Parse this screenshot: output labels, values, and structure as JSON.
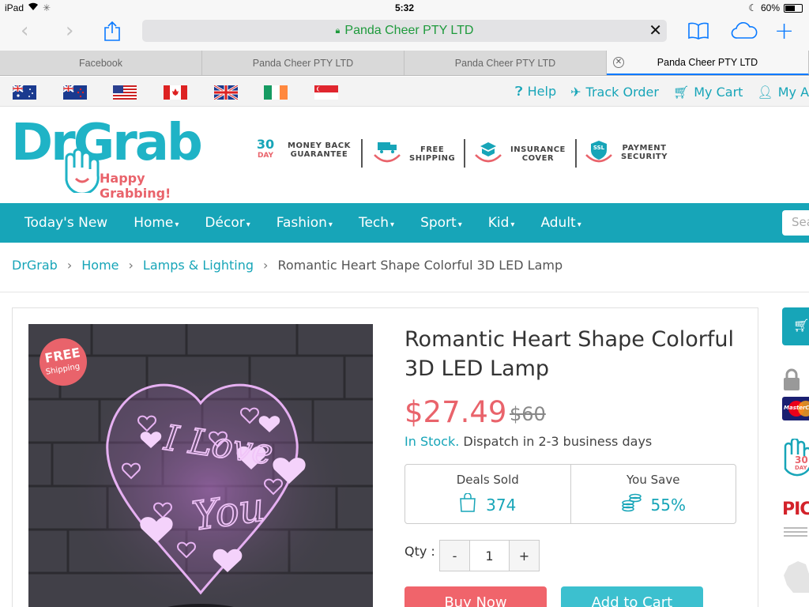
{
  "status_bar": {
    "device": "iPad",
    "time": "5:32",
    "battery": "60%",
    "battery_level": 0.6
  },
  "browser": {
    "url_text": "Panda Cheer PTY LTD",
    "tabs": [
      {
        "label": "Facebook"
      },
      {
        "label": "Panda Cheer PTY LTD"
      },
      {
        "label": "Panda Cheer PTY LTD"
      },
      {
        "label": "Panda Cheer PTY LTD",
        "active": true
      }
    ]
  },
  "topbar": {
    "flags": [
      "australia-flag",
      "new-zealand-flag",
      "usa-flag",
      "canada-flag",
      "uk-flag",
      "ireland-flag",
      "singapore-flag"
    ],
    "links": [
      {
        "label": "Help",
        "icon": "question-circle-icon"
      },
      {
        "label": "Track Order",
        "icon": "plane-icon"
      },
      {
        "label": "My Cart",
        "icon": "cart-icon"
      },
      {
        "label": "My Acc",
        "icon": "user-icon"
      }
    ]
  },
  "header": {
    "logo_text": "DrGrab",
    "tagline": "Happy Grabbing!",
    "badges": [
      {
        "num": "30",
        "unit": "DAY",
        "line1": "MONEY BACK",
        "line2": "GUARANTEE"
      },
      {
        "line1": "FREE",
        "line2": "SHIPPING"
      },
      {
        "line1": "INSURANCE",
        "line2": "COVER"
      },
      {
        "icon_text": "SSL",
        "line1": "PAYMENT",
        "line2": "SECURITY"
      }
    ]
  },
  "menu": {
    "items": [
      {
        "label": "Today's New",
        "caret": false
      },
      {
        "label": "Home",
        "caret": true
      },
      {
        "label": "Décor",
        "caret": true
      },
      {
        "label": "Fashion",
        "caret": true
      },
      {
        "label": "Tech",
        "caret": true
      },
      {
        "label": "Sport",
        "caret": true
      },
      {
        "label": "Kid",
        "caret": true
      },
      {
        "label": "Adult",
        "caret": true
      }
    ],
    "search_placeholder": "Sea"
  },
  "breadcrumb": {
    "items": [
      "DrGrab",
      "Home",
      "Lamps & Lighting"
    ],
    "current": "Romantic Heart Shape Colorful 3D LED Lamp"
  },
  "product": {
    "title": "Romantic Heart Shape Colorful 3D LED Lamp",
    "price": "$27.49",
    "old_price": "$60",
    "stock_status": "In Stock.",
    "dispatch": "Dispatch in 2-3 business days",
    "free_badge_line1": "FREE",
    "free_badge_line2": "Shipping",
    "lamp_text_1": "I Love",
    "lamp_text_2": "You",
    "deals_label": "Deals Sold",
    "deals_value": "374",
    "save_label": "You Save",
    "save_value": "55%",
    "qty_label": "Qty :",
    "qty_value": "1",
    "minus": "-",
    "plus": "+",
    "buy_now": "Buy Now",
    "add_to_cart": "Add to Cart"
  },
  "side": {
    "thirty": "30",
    "day": "DAY",
    "picc": "PICC",
    "mastercard": "MasterCard"
  },
  "colors": {
    "brand": "#17a5b8",
    "price": "#e9636b",
    "buy": "#f0646b"
  }
}
